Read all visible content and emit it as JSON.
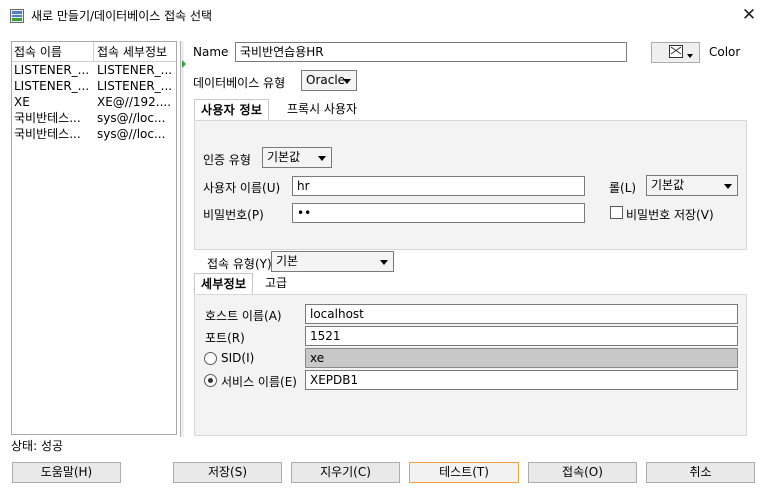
{
  "window": {
    "title": "새로 만들기/데이터베이스 접속 선택"
  },
  "connections": {
    "columns": [
      "접속 이름",
      "접속 세부정보"
    ],
    "rows": [
      {
        "name": "LISTENER_...",
        "details": "LISTENER_..."
      },
      {
        "name": "LISTENER_...",
        "details": "LISTENER_..."
      },
      {
        "name": "XE",
        "details": "XE@//192...."
      },
      {
        "name": "국비반테스...",
        "details": "sys@//loc..."
      },
      {
        "name": "국비반테스...",
        "details": "sys@//loc..."
      }
    ]
  },
  "form": {
    "name_label": "Name",
    "name_value": "국비반연습용HR",
    "color_label": "Color",
    "db_type_label": "데이터베이스 유형",
    "db_type_value": "Oracle",
    "tabs": [
      "사용자 정보",
      "프록시 사용자"
    ],
    "auth_type_label": "인증 유형",
    "auth_type_value": "기본값",
    "username_label": "사용자 이름(U)",
    "username_value": "hr",
    "role_label": "롤(L)",
    "role_value": "기본값",
    "password_label": "비밀번호(P)",
    "password_value": "••",
    "save_password_label": "비밀번호 저장(V)",
    "conn_type_label": "접속 유형(Y)",
    "conn_type_value": "기본",
    "detail_tabs": [
      "세부정보",
      "고급"
    ],
    "hostname_label": "호스트 이름(A)",
    "hostname_value": "localhost",
    "port_label": "포트(R)",
    "port_value": "1521",
    "sid_label": "SID(I)",
    "sid_value": "xe",
    "service_label": "서비스 이름(E)",
    "service_value": "XEPDB1",
    "selected_mode": "service"
  },
  "status": {
    "text": "상태: 성공"
  },
  "buttons": {
    "help": "도움말(H)",
    "save": "저장(S)",
    "clear": "지우기(C)",
    "test": "테스트(T)",
    "connect": "접속(O)",
    "cancel": "취소"
  },
  "colors": {
    "accent_focus": "#f0a040",
    "grip": "#3a9a3a"
  }
}
